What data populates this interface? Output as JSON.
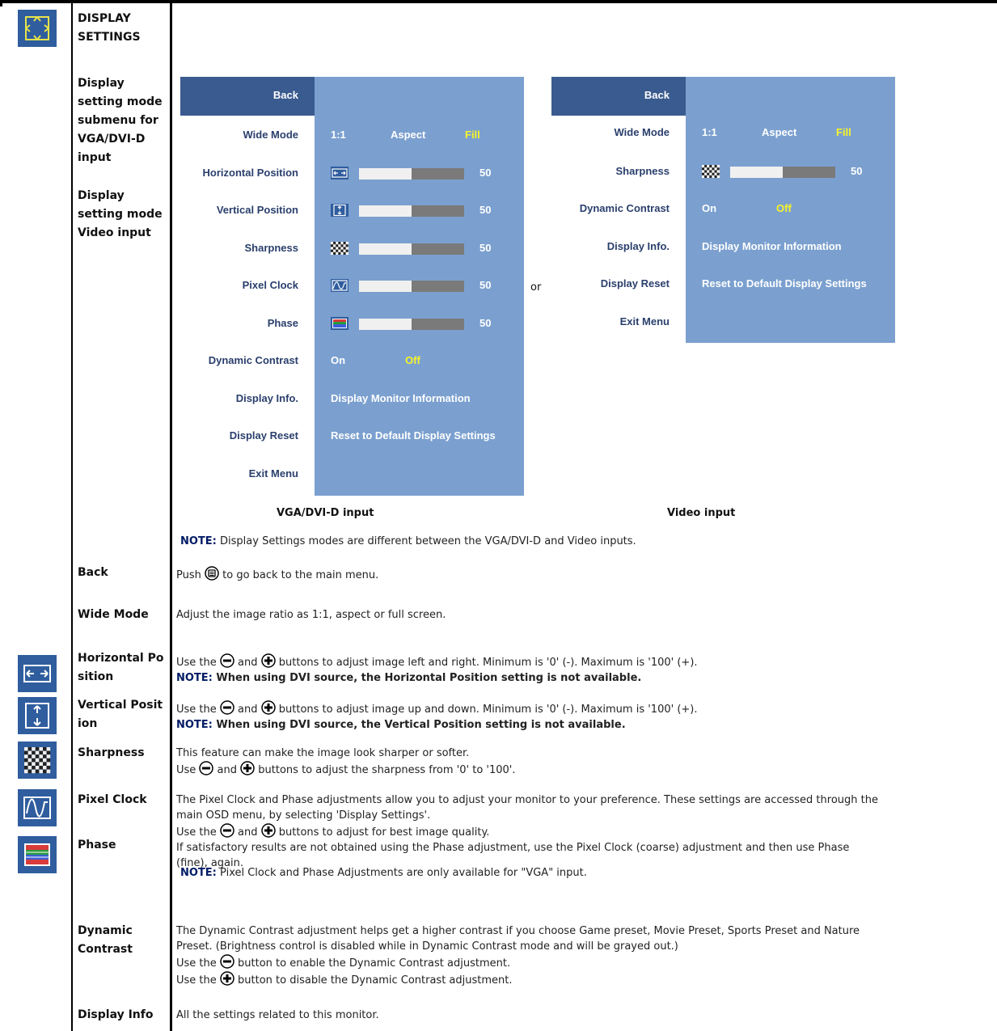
{
  "section": {
    "title": "DISPLAY SETTINGS"
  },
  "intro": {
    "label_vga": "Display setting mode submenu for VGA/DVI-D input",
    "label_video": "Display setting mode Video input"
  },
  "osd_vga": {
    "back": "Back",
    "rows": [
      {
        "label": "Wide Mode",
        "options": [
          "1:1",
          "Aspect",
          "Fill"
        ]
      },
      {
        "label": "Horizontal Position",
        "value": 50,
        "icon": "horizontal-position-icon"
      },
      {
        "label": "Vertical Position",
        "value": 50,
        "icon": "vertical-position-icon"
      },
      {
        "label": "Sharpness",
        "value": 50,
        "icon": "sharpness-icon"
      },
      {
        "label": "Pixel Clock",
        "value": 50,
        "icon": "pixel-clock-icon"
      },
      {
        "label": "Phase",
        "value": 50,
        "icon": "phase-icon"
      },
      {
        "label": "Dynamic Contrast",
        "options": [
          "On",
          "Off"
        ]
      },
      {
        "label": "Display Info.",
        "text": "Display Monitor Information"
      },
      {
        "label": "Display Reset",
        "text": "Reset to Default Display Settings"
      },
      {
        "label": "Exit Menu"
      }
    ]
  },
  "osd_video": {
    "back": "Back",
    "rows": [
      {
        "label": "Wide Mode",
        "options": [
          "1:1",
          "Aspect",
          "Fill"
        ]
      },
      {
        "label": "Sharpness",
        "value": 50,
        "icon": "sharpness-icon"
      },
      {
        "label": "Dynamic Contrast",
        "options": [
          "On",
          "Off"
        ]
      },
      {
        "label": "Display Info.",
        "text": "Display Monitor Information"
      },
      {
        "label": "Display Reset",
        "text": "Reset to Default Display Settings"
      },
      {
        "label": "Exit Menu"
      }
    ]
  },
  "or_text": "or",
  "captions": {
    "vga": "VGA/DVI-D input",
    "video": "Video input"
  },
  "note_modes": {
    "prefix": "NOTE:",
    "text": " Display Settings modes are different between the VGA/DVI-D and Video inputs."
  },
  "items": {
    "back": {
      "label": "Back",
      "pre": "Push ",
      "post": " to go back to the main menu."
    },
    "wide": {
      "label": "Wide Mode",
      "text": "Adjust the image ratio as 1:1, aspect or full screen."
    },
    "hpos": {
      "label1": "Horizontal Po",
      "label2": "sition",
      "pre": "Use the ",
      "mid": " and ",
      "post": " buttons to adjust image left and right. Minimum is '0' (-). Maximum is '100' (+).",
      "note_prefix": "NOTE:",
      "note": " When using DVI source, the Horizontal Position setting is not available."
    },
    "vpos": {
      "label1": "Vertical Posit",
      "label2": "ion",
      "pre": "Use the ",
      "mid": " and ",
      "post": " buttons to adjust image up and down. Minimum is '0' (-). Maximum is '100' (+).",
      "note_prefix": "NOTE:",
      "note": " When using DVI source, the Vertical Position setting is not available."
    },
    "sharp": {
      "label": "Sharpness",
      "line1": "This feature can make the image look sharper or softer.",
      "pre": "Use  ",
      "mid": " and ",
      "post": " buttons to adjust the sharpness from '0' to '100'."
    },
    "clock": {
      "label": "Pixel Clock",
      "line1": "The Pixel Clock and Phase adjustments allow you to adjust your monitor to your preference. These settings are accessed through the",
      "line2": "main OSD menu, by selecting 'Display Settings'.",
      "pre": "Use the ",
      "mid": " and ",
      "post": " buttons to adjust for best image quality.",
      "line4": "If satisfactory results are not obtained using the Phase adjustment, use the Pixel Clock (coarse) adjustment and then use Phase",
      "line5": "(fine), again.",
      "note_prefix": "NOTE:",
      "note": " Pixel Clock and Phase Adjustments are only available for \"VGA\" input."
    },
    "phase": {
      "label": "Phase"
    },
    "dyn": {
      "label1": "Dynamic",
      "label2": "Contrast",
      "line1": "The Dynamic Contrast adjustment helps get a higher contrast if you choose Game preset, Movie Preset, Sports Preset and Nature",
      "line2": "Preset. (Brightness control is disabled while in Dynamic Contrast mode and will be grayed out.)",
      "pre1": "Use the ",
      "post1": " button to enable the Dynamic Contrast adjustment.",
      "pre2": "Use the ",
      "post2": " button to disable the Dynamic Contrast adjustment."
    },
    "info": {
      "label": "Display Info",
      "text": "All the settings related to this monitor."
    }
  }
}
